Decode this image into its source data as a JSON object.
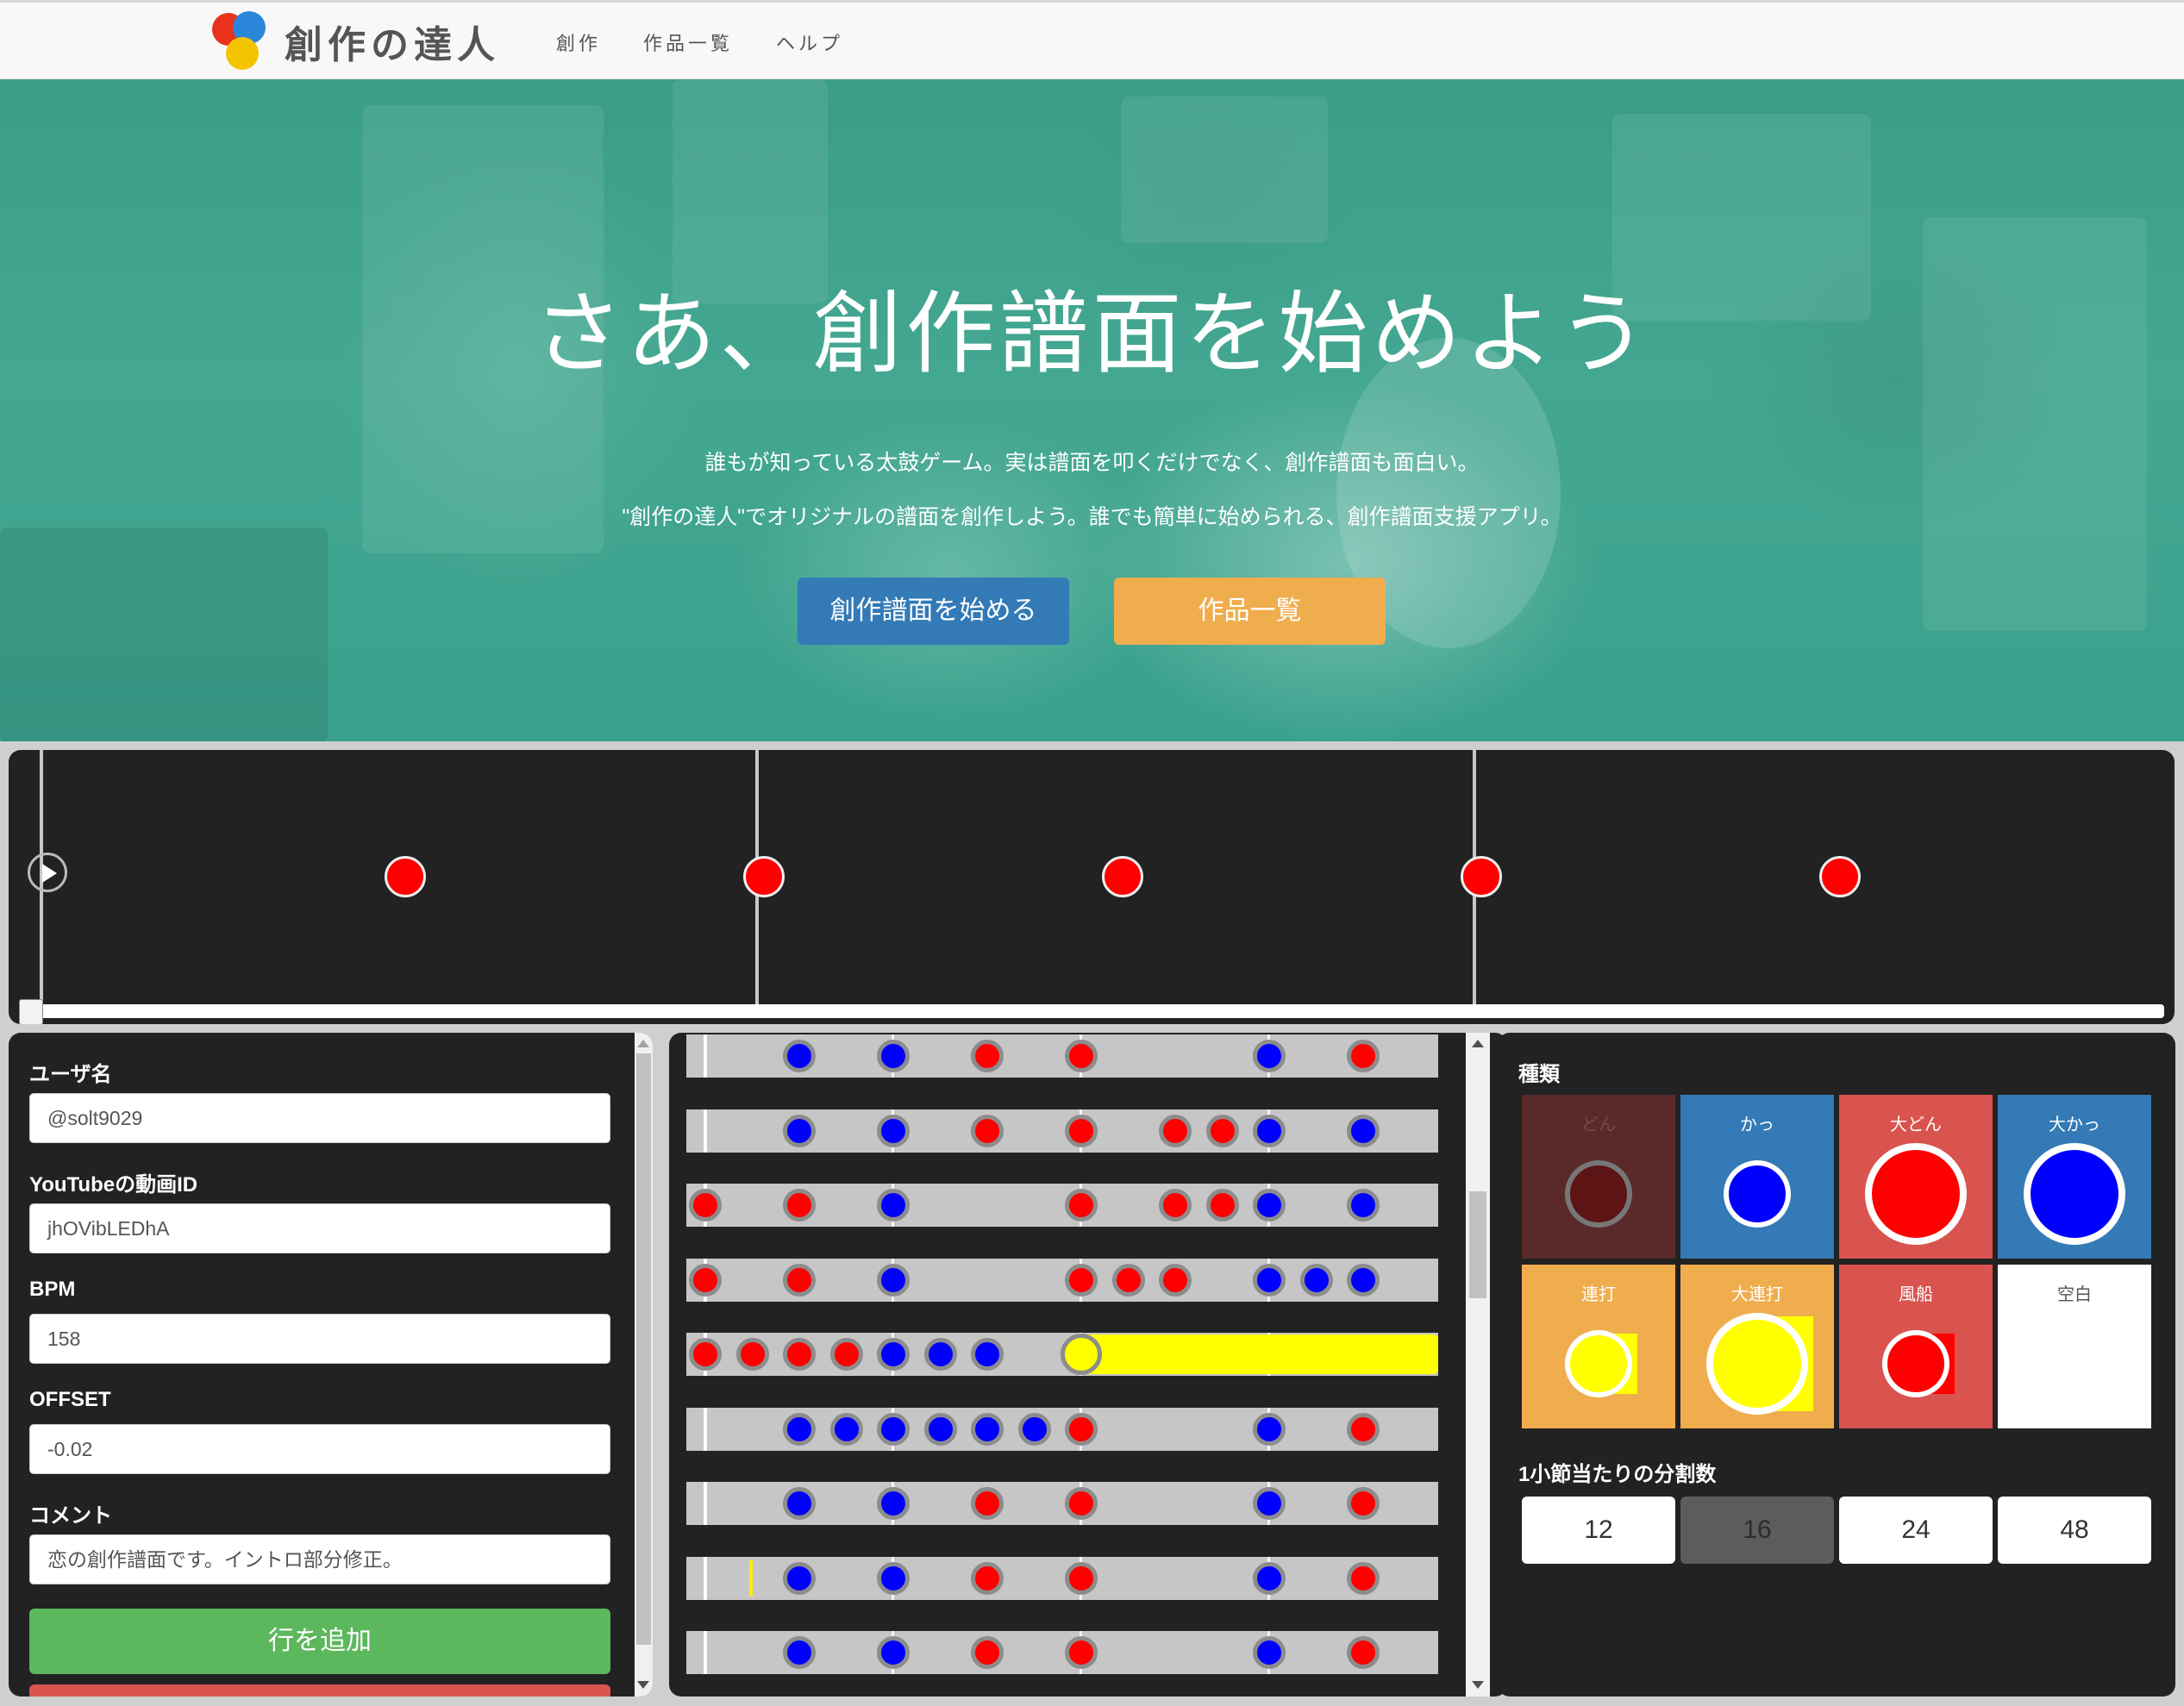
{
  "navbar": {
    "brand": "創作の達人",
    "links": [
      "創作",
      "作品一覧",
      "ヘルプ"
    ]
  },
  "hero": {
    "title": "さあ、創作譜面を始めよう",
    "line1": "誰もが知っている太鼓ゲーム。実は譜面を叩くだけでなく、創作譜面も面白い。",
    "line2": "\"創作の達人\"でオリジナルの譜面を創作しよう。誰でも簡単に始められる、創作譜面支援アプリ。",
    "start_button": "創作譜面を始める",
    "works_button": "作品一覧"
  },
  "player": {
    "notes": [
      "don",
      "don",
      "don",
      "don",
      "don"
    ],
    "progress": 0.0
  },
  "form": {
    "username_label": "ユーザ名",
    "username_value": "@solt9029",
    "video_id_label": "YouTubeの動画ID",
    "video_id_value": "jhOVibLEDhA",
    "bpm_label": "BPM",
    "bpm_value": "158",
    "offset_label": "OFFSET",
    "offset_value": "-0.02",
    "comment_label": "コメント",
    "comment_value": "恋の創作譜面です。イントロ部分修正。",
    "add_row_button": "行を追加"
  },
  "editor": {
    "steps_per_row": 16,
    "rows": [
      {
        "notes": [
          [
            2,
            "ka"
          ],
          [
            4,
            "ka"
          ],
          [
            6,
            "don"
          ],
          [
            8,
            "don"
          ],
          [
            12,
            "ka"
          ],
          [
            14,
            "don"
          ]
        ]
      },
      {
        "notes": [
          [
            2,
            "ka"
          ],
          [
            4,
            "ka"
          ],
          [
            6,
            "don"
          ],
          [
            8,
            "don"
          ],
          [
            10,
            "don"
          ],
          [
            11,
            "don"
          ],
          [
            12,
            "ka"
          ],
          [
            14,
            "ka"
          ]
        ]
      },
      {
        "notes": [
          [
            0,
            "don"
          ],
          [
            2,
            "don"
          ],
          [
            4,
            "ka"
          ],
          [
            8,
            "don"
          ],
          [
            10,
            "don"
          ],
          [
            11,
            "don"
          ],
          [
            12,
            "ka"
          ],
          [
            14,
            "ka"
          ]
        ]
      },
      {
        "notes": [
          [
            0,
            "don"
          ],
          [
            2,
            "don"
          ],
          [
            4,
            "ka"
          ],
          [
            8,
            "don"
          ],
          [
            9,
            "don"
          ],
          [
            10,
            "don"
          ],
          [
            12,
            "ka"
          ],
          [
            13,
            "ka"
          ],
          [
            14,
            "ka"
          ]
        ]
      },
      {
        "notes": [
          [
            0,
            "don"
          ],
          [
            1,
            "don"
          ],
          [
            2,
            "don"
          ],
          [
            3,
            "don"
          ],
          [
            4,
            "ka"
          ],
          [
            5,
            "ka"
          ],
          [
            6,
            "ka"
          ]
        ],
        "roll_start": 8
      },
      {
        "notes": [
          [
            2,
            "ka"
          ],
          [
            3,
            "ka"
          ],
          [
            4,
            "ka"
          ],
          [
            5,
            "ka"
          ],
          [
            6,
            "ka"
          ],
          [
            7,
            "ka"
          ],
          [
            8,
            "don"
          ],
          [
            12,
            "ka"
          ],
          [
            14,
            "don"
          ]
        ]
      },
      {
        "notes": [
          [
            2,
            "ka"
          ],
          [
            4,
            "ka"
          ],
          [
            6,
            "don"
          ],
          [
            8,
            "don"
          ],
          [
            12,
            "ka"
          ],
          [
            14,
            "don"
          ]
        ]
      },
      {
        "notes": [
          [
            2,
            "ka"
          ],
          [
            4,
            "ka"
          ],
          [
            6,
            "don"
          ],
          [
            8,
            "don"
          ],
          [
            12,
            "ka"
          ],
          [
            14,
            "don"
          ]
        ]
      },
      {
        "notes": [
          [
            2,
            "ka"
          ],
          [
            4,
            "ka"
          ],
          [
            6,
            "don"
          ],
          [
            8,
            "don"
          ],
          [
            12,
            "ka"
          ],
          [
            14,
            "don"
          ]
        ]
      }
    ]
  },
  "palette": {
    "title": "種類",
    "types": [
      {
        "name": "どん",
        "bg": "#5a2a2a",
        "fill": "#5c1414",
        "ring": "#777777",
        "size": "small"
      },
      {
        "name": "かっ",
        "bg": "#337ab7",
        "fill": "#0000ff",
        "ring": "#ffffff",
        "size": "small"
      },
      {
        "name": "大どん",
        "bg": "#d9534f",
        "fill": "#ff0000",
        "ring": "#ffffff",
        "size": "big"
      },
      {
        "name": "大かっ",
        "bg": "#337ab7",
        "fill": "#0000ff",
        "ring": "#ffffff",
        "size": "big"
      },
      {
        "name": "連打",
        "bg": "#f0ad4e",
        "fill": "#ffff00",
        "ring": "#ffffff",
        "size": "small"
      },
      {
        "name": "大連打",
        "bg": "#f0ad4e",
        "fill": "#ffff00",
        "ring": "#ffffff",
        "size": "big"
      },
      {
        "name": "風船",
        "bg": "#d9534f",
        "fill": "#ff0000",
        "ring": "#ffffff",
        "size": "small"
      },
      {
        "name": "空白",
        "bg": "#ffffff",
        "fill": "",
        "ring": "",
        "size": "none"
      }
    ],
    "division_title": "1小節当たりの分割数",
    "divisions": [
      "12",
      "16",
      "24",
      "48"
    ],
    "selected_division": "16"
  },
  "colors": {
    "don": "#ff0000",
    "ka": "#0000ff",
    "roll": "#ffff00"
  }
}
